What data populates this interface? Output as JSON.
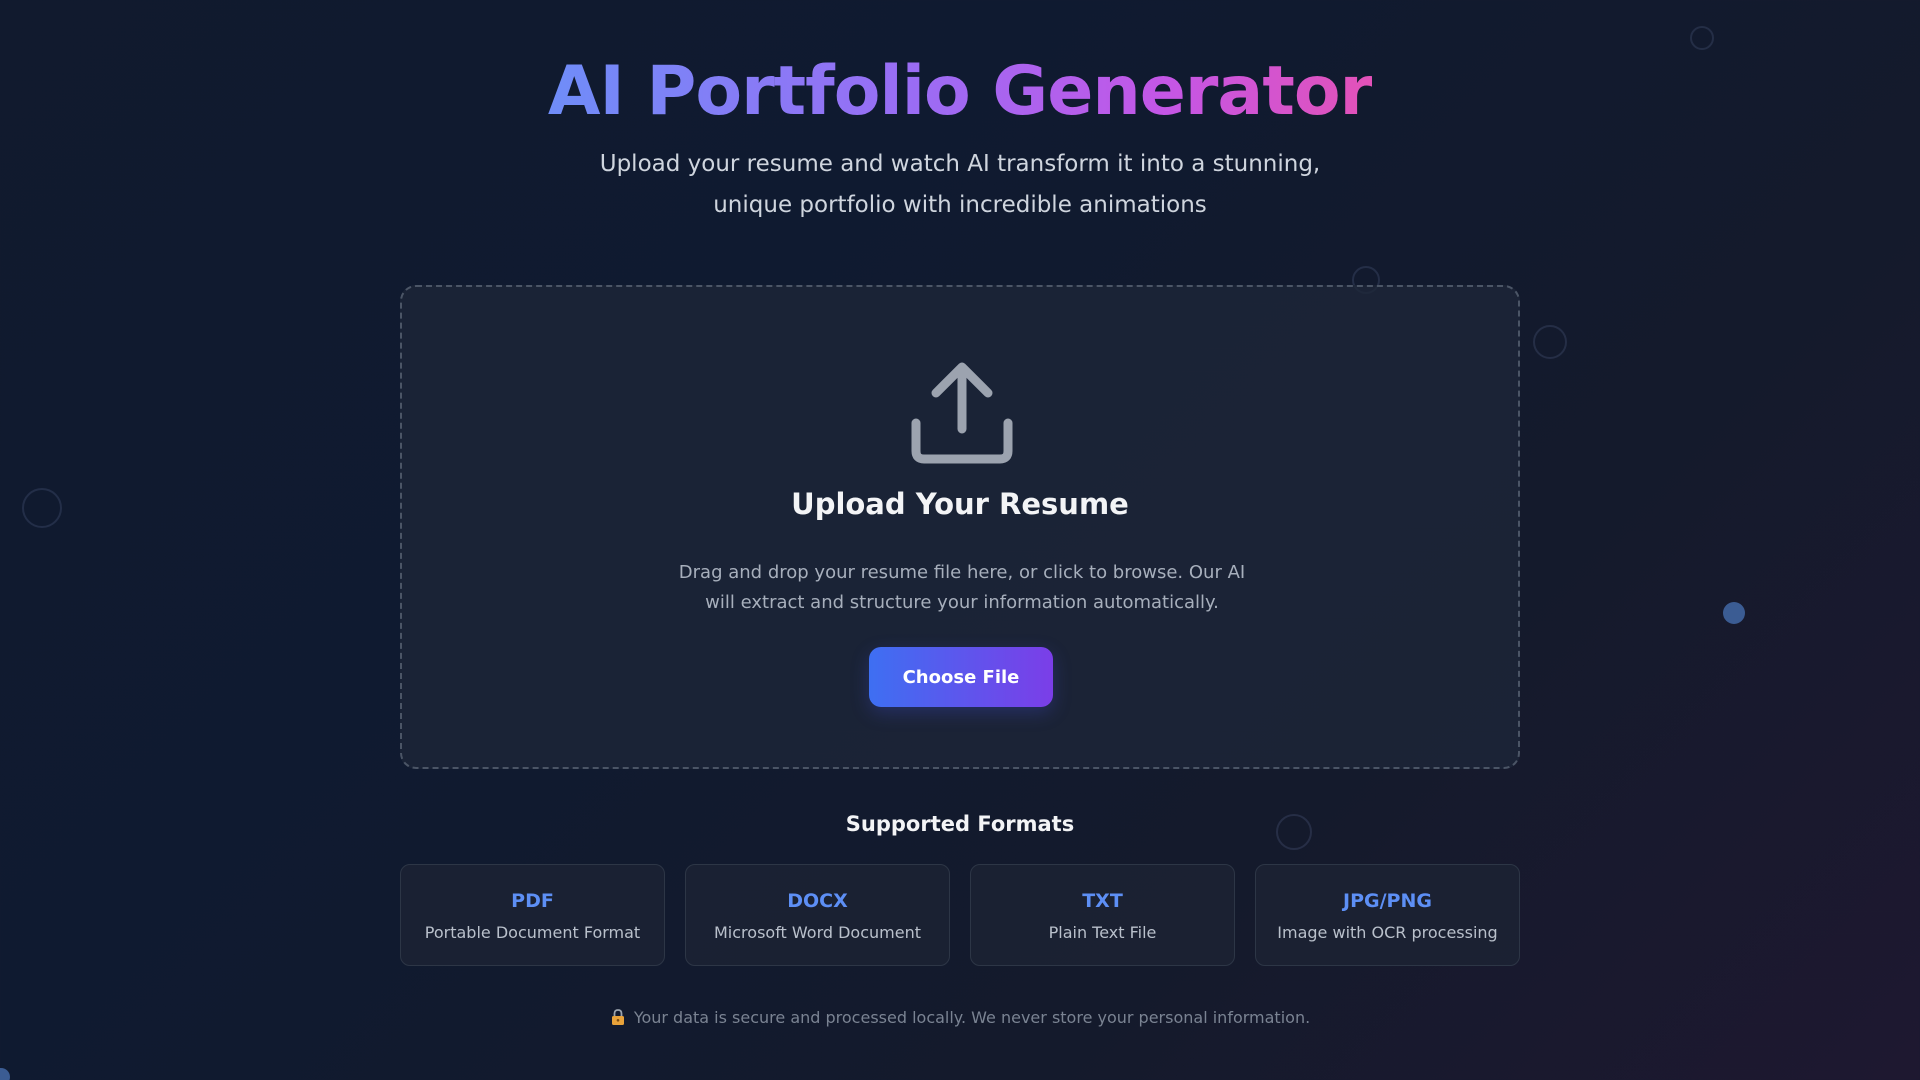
{
  "header": {
    "title": "AI Portfolio Generator",
    "subtitle": "Upload your resume and watch AI transform it into a stunning, unique portfolio with incredible animations"
  },
  "upload": {
    "icon": "upload-icon",
    "title": "Upload Your Resume",
    "description": "Drag and drop your resume file here, or click to browse. Our AI will extract and structure your information automatically.",
    "button_label": "Choose File"
  },
  "formats": {
    "title": "Supported Formats",
    "items": [
      {
        "name": "PDF",
        "description": "Portable Document Format"
      },
      {
        "name": "DOCX",
        "description": "Microsoft Word Document"
      },
      {
        "name": "TXT",
        "description": "Plain Text File"
      },
      {
        "name": "JPG/PNG",
        "description": "Image with OCR processing"
      }
    ]
  },
  "footer": {
    "icon": "lock-icon",
    "note": "Your data is secure and processed locally. We never store your personal information."
  },
  "colors": {
    "accent_blue": "#5d8ff5",
    "button_gradient_start": "#3e6ff2",
    "button_gradient_end": "#7b3ee8",
    "title_gradient_start": "#6f8df8",
    "title_gradient_end": "#e352b8"
  }
}
